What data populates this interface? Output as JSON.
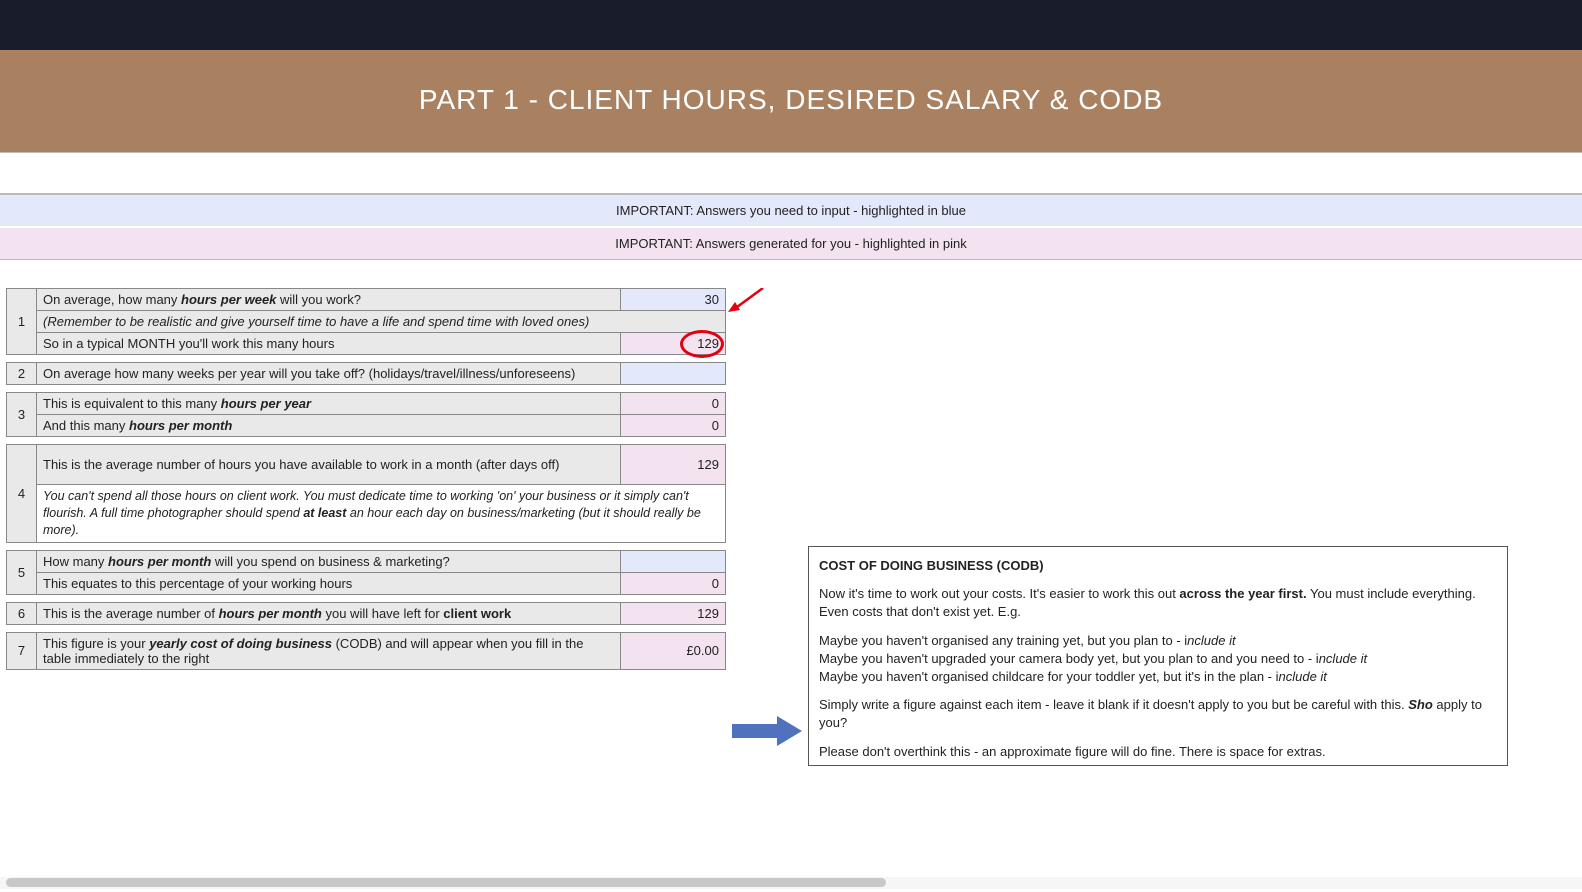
{
  "title": "PART 1 - CLIENT HOURS, DESIRED SALARY & CODB",
  "notice_blue": "IMPORTANT: Answers you need to input - highlighted in blue",
  "notice_pink": "IMPORTANT: Answers generated for you - highlighted in pink",
  "rows": {
    "r1": {
      "num": "1",
      "q_pre": "On average, how many ",
      "q_bold": "hours per week",
      "q_post": " will you work?",
      "val": "30",
      "note": "(Remember to be realistic and give yourself time to have a life and spend time with loved ones)",
      "monthly_label": "So in a typical MONTH you'll work this many hours",
      "monthly_val": "129"
    },
    "r2": {
      "num": "2",
      "q": "On average how many weeks per year will you take off? (holidays/travel/illness/unforeseens)",
      "val": ""
    },
    "r3": {
      "num": "3",
      "a_pre": "This is equivalent to this many ",
      "a_bold": "hours per year",
      "a_val": "0",
      "b_pre": "And this many ",
      "b_bold": "hours per month",
      "b_val": "0"
    },
    "r4": {
      "num": "4",
      "q": "This is the average number of hours you have available to work in a month (after days off)",
      "val": "129",
      "note_pre": "You can't spend all those hours on client work. You must dedicate time to working 'on' your business or it simply can't flourish. A full time photographer should spend ",
      "note_bold": "at least",
      "note_post": " an hour each day on business/marketing (but it should really be more)."
    },
    "r5": {
      "num": "5",
      "a_pre": "How many ",
      "a_bold": "hours per month",
      "a_post": " will you spend on business & marketing?",
      "a_val": "",
      "b": "This equates to this percentage of your working hours",
      "b_val": "0"
    },
    "r6": {
      "num": "6",
      "q_pre": "This is the average number of ",
      "q_bold": "hours per month",
      "q_mid": " you will have left for ",
      "q_bold2": "client work",
      "val": "129"
    },
    "r7": {
      "num": "7",
      "q_pre": "This figure is your ",
      "q_bold": "yearly cost of doing business",
      "q_post": " (CODB) and will appear when you fill in the table immediately to the right",
      "val": "£0.00"
    }
  },
  "codb": {
    "header": "COST OF DOING BUSINESS (CODB)",
    "p1a": "Now it's time to work out your costs. It's easier to work this out ",
    "p1b": "across the year first.",
    "p1c": " You must include everything. Even costs that don't exist yet. E.g.",
    "l1a": "Maybe you haven't organised any training yet, but you plan to - i",
    "l1b": "nclude it",
    "l2a": "Maybe you haven't upgraded your camera body yet, but you plan to and you need to - i",
    "l2b": "nclude it",
    "l3a": "Maybe you haven't organised childcare for your toddler yet, but it's in the plan - i",
    "l3b": "nclude it",
    "p2a": "Simply write a figure against each item - leave it blank if it doesn't apply to you but be careful with this. ",
    "p2b": "Sho",
    "p2c": " apply to you?",
    "p3": "Please don't overthink this - an approximate figure will do fine. There is space for extras."
  }
}
